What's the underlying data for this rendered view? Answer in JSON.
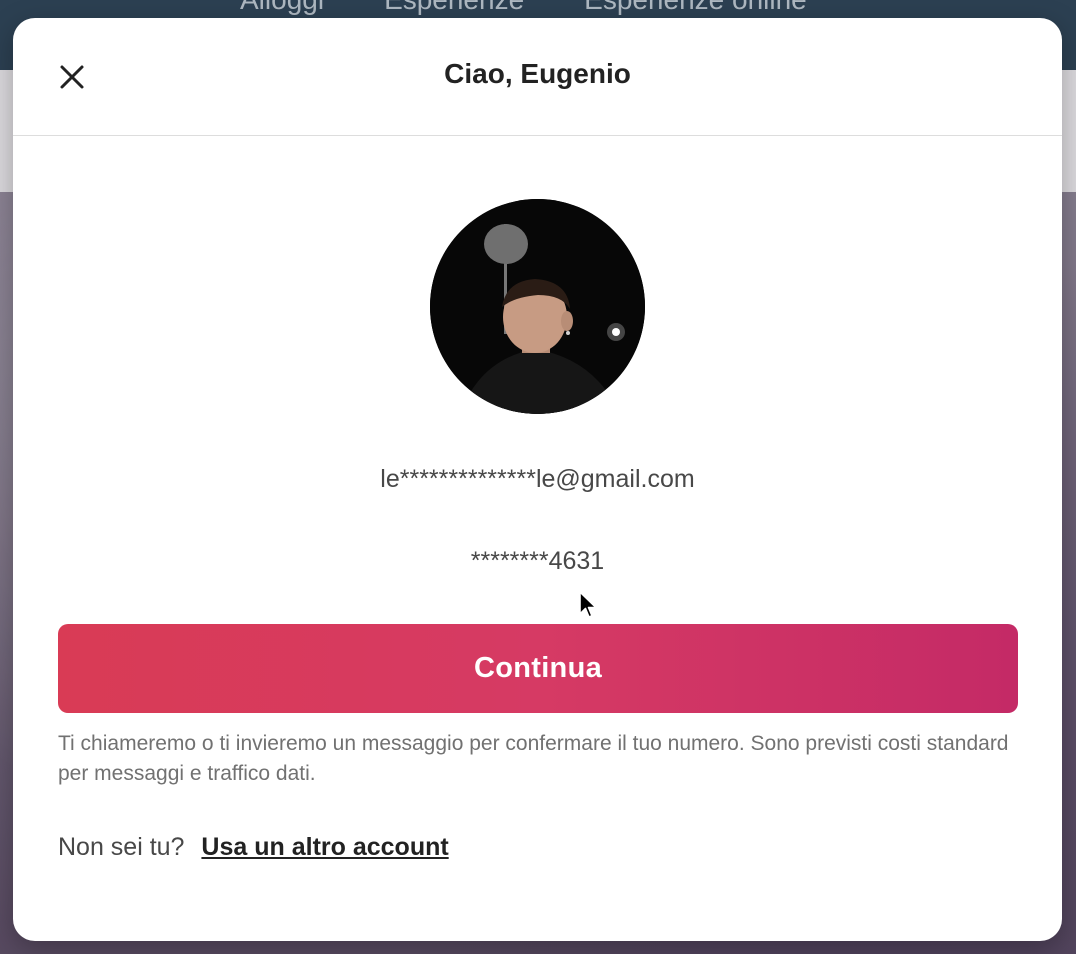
{
  "backdrop": {
    "nav_tabs": [
      "Alloggi",
      "Esperienze",
      "Esperienze online"
    ]
  },
  "modal": {
    "title": "Ciao, Eugenio",
    "close_icon": "close-icon",
    "avatar_alt": "Foto profilo",
    "email": "le**************le@gmail.com",
    "phone": "********4631",
    "continue_label": "Continua",
    "disclaimer": "Ti chiameremo o ti invieremo un messaggio per confermare il tuo numero. Sono previsti costi standard per messaggi e traffico dati.",
    "not_you_text": "Non sei tu?",
    "other_account_link": "Usa un altro account"
  },
  "colors": {
    "brand_gradient_start": "#d93b55",
    "brand_gradient_end": "#c42a66",
    "title_text": "#222222",
    "body_text": "#484848",
    "muted_text": "#717171"
  }
}
